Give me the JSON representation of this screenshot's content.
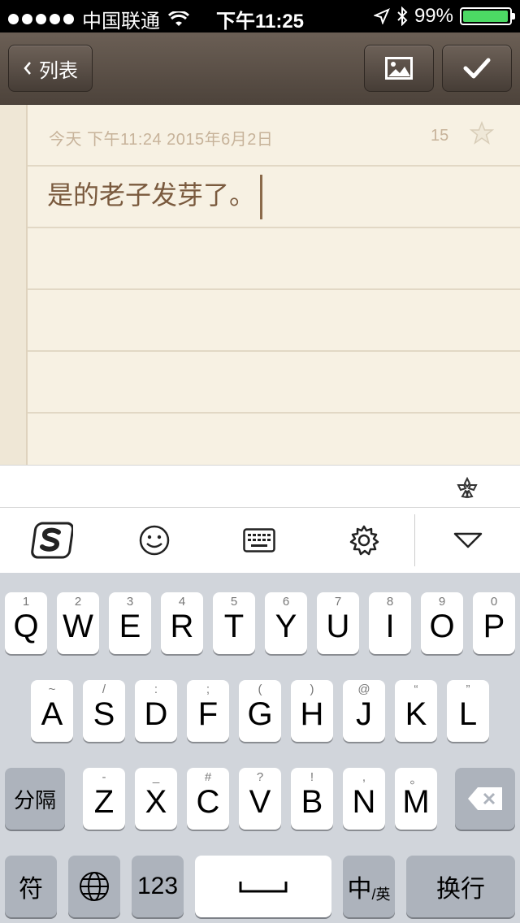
{
  "status": {
    "carrier": "中国联通",
    "time": "下午11:25",
    "battery": "99%",
    "battery_level": 0.99
  },
  "nav": {
    "back_label": "列表"
  },
  "note": {
    "meta": "今天 下午11:24 2015年6月2日",
    "count": "15",
    "text": "是的老子发芽了。"
  },
  "keyboard": {
    "row1": [
      {
        "main": "Q",
        "sub": "1"
      },
      {
        "main": "W",
        "sub": "2"
      },
      {
        "main": "E",
        "sub": "3"
      },
      {
        "main": "R",
        "sub": "4"
      },
      {
        "main": "T",
        "sub": "5"
      },
      {
        "main": "Y",
        "sub": "6"
      },
      {
        "main": "U",
        "sub": "7"
      },
      {
        "main": "I",
        "sub": "8"
      },
      {
        "main": "O",
        "sub": "9"
      },
      {
        "main": "P",
        "sub": "0"
      }
    ],
    "row2": [
      {
        "main": "A",
        "sub": "~"
      },
      {
        "main": "S",
        "sub": "/"
      },
      {
        "main": "D",
        "sub": ":"
      },
      {
        "main": "F",
        "sub": ";"
      },
      {
        "main": "G",
        "sub": "("
      },
      {
        "main": "H",
        "sub": ")"
      },
      {
        "main": "J",
        "sub": "@"
      },
      {
        "main": "K",
        "sub": "“"
      },
      {
        "main": "L",
        "sub": "”"
      }
    ],
    "row3": [
      {
        "main": "Z",
        "sub": "-"
      },
      {
        "main": "X",
        "sub": "_"
      },
      {
        "main": "C",
        "sub": "#"
      },
      {
        "main": "V",
        "sub": "?"
      },
      {
        "main": "B",
        "sub": "!"
      },
      {
        "main": "N",
        "sub": ","
      },
      {
        "main": "M",
        "sub": "。"
      }
    ],
    "shift_label": "分隔",
    "symbol_label": "符",
    "num_label": "123",
    "lang_main": "中",
    "lang_sub": "/英",
    "return_label": "换行"
  }
}
